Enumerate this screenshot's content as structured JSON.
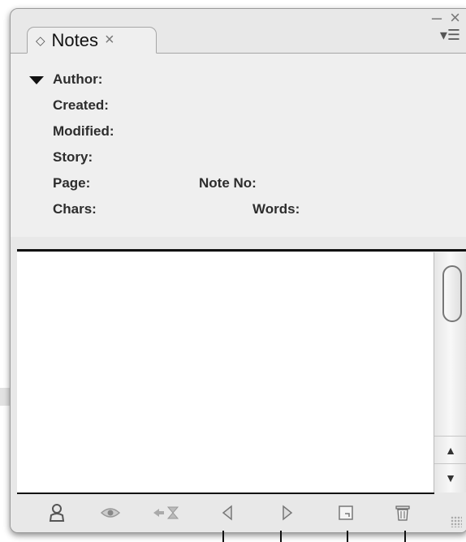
{
  "window": {
    "minimize_icon": "minimize-icon",
    "close_icon": "close-icon"
  },
  "tab": {
    "label": "Notes",
    "close": "×",
    "grip": "◇"
  },
  "panel_menu": "▾☰",
  "info": {
    "author_label": "Author:",
    "created_label": "Created:",
    "modified_label": "Modified:",
    "story_label": "Story:",
    "page_label": "Page:",
    "note_no_label": "Note No:",
    "chars_label": "Chars:",
    "words_label": "Words:"
  },
  "note_body": "",
  "scroll": {
    "up": "▲",
    "down": "▼"
  },
  "toolbar": {
    "icons": [
      "user-icon",
      "eye-icon",
      "go-to-text-icon",
      "previous-note-icon",
      "next-note-icon",
      "new-note-icon",
      "delete-note-icon"
    ]
  },
  "colors": {
    "panel_bg": "#e8e8e8",
    "info_bg": "#efefef",
    "label_text": "#2d2d2d",
    "divider": "#111111"
  }
}
